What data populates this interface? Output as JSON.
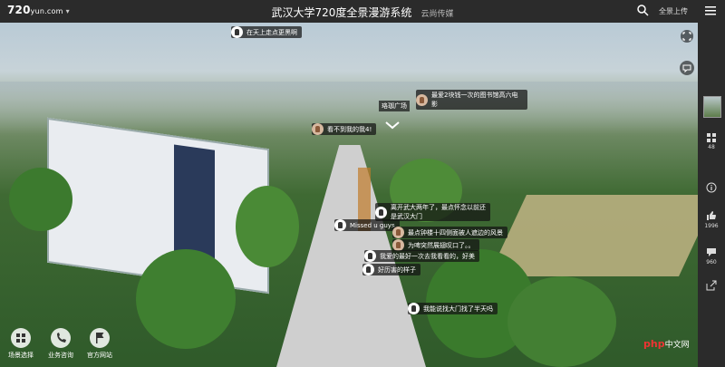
{
  "header": {
    "logo": "720",
    "logo_suffix": "yun",
    "logo_tld": ".com",
    "title": "武汉大学720度全景漫游系统",
    "publisher": "云尚传媒",
    "upload_label": "全景上传"
  },
  "comments": [
    {
      "text": "在天上走点更黑啊"
    },
    {
      "text": "最爱2块钱一次的图书馆高六电影"
    },
    {
      "text": "看不到我的我4!"
    },
    {
      "text": "离开武大两年了，最点怀念以前还是武汉大门"
    },
    {
      "text": "Missed u guys"
    },
    {
      "text": "最点钟楼十四侧面被人遮边的风景"
    },
    {
      "text": "为啤突然展翅叹口了。。"
    },
    {
      "text": "我爱的最好一次去我看看的，好美"
    },
    {
      "text": "好历害的样子"
    },
    {
      "text": "我能说找大门找了半天吗"
    }
  ],
  "hotspot": {
    "label": "珞珈广场"
  },
  "sidebar": {
    "scenes_count": "48",
    "likes": "1996",
    "comments_count": "960"
  },
  "bottom_bar": [
    {
      "label": "场景选择",
      "icon": "grid-icon"
    },
    {
      "label": "业务咨询",
      "icon": "phone-icon"
    },
    {
      "label": "官方网站",
      "icon": "flag-icon"
    }
  ],
  "watermark": {
    "brand": "php",
    "suffix": "中文网"
  },
  "colors": {
    "bar": "#2b2b2b",
    "bubble": "rgba(20,20,20,0.72)"
  }
}
